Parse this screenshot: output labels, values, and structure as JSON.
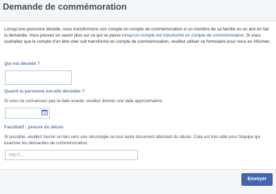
{
  "header": {
    "title": "Demande de commémoration"
  },
  "intro": {
    "text_1": "Lorsqu'une personne décède, nous transformons son compte en compte de commémoration si un membre de sa famille ou un ami en fait la demande. Vous pouvez en savoir plus sur ce qui se passe ",
    "link": "lorsqu'un compte est transformé en compte de commémoration",
    "text_2": ". Si vous souhaitez que le compte d'un être cher soit transformé en compte de commémoration, veuillez utiliser ce formulaire pour nous en informer."
  },
  "fields": {
    "who": {
      "label": "Qui est décédé ?",
      "value": ""
    },
    "when": {
      "label": "Quand la personne est-elle décédée ?",
      "hint": "Si vous ne connaissez pas la date exacte, veuillez donner une date approximative.",
      "value": ""
    },
    "proof": {
      "label": "Facultatif : preuve du décès",
      "hint": "Si possible, veuillez fournir un lien vers une nécrologie ou tout autre document attestant du décès. Cela est très utile pour l'équipe qui examine les demandes de commémoration.",
      "placeholder": "http://..."
    }
  },
  "footer": {
    "submit_label": "Envoyer"
  },
  "colors": {
    "label": "#627aad",
    "link": "#365899",
    "button": "#4267b2"
  },
  "icons": {
    "date_picker": "calendar-icon"
  }
}
